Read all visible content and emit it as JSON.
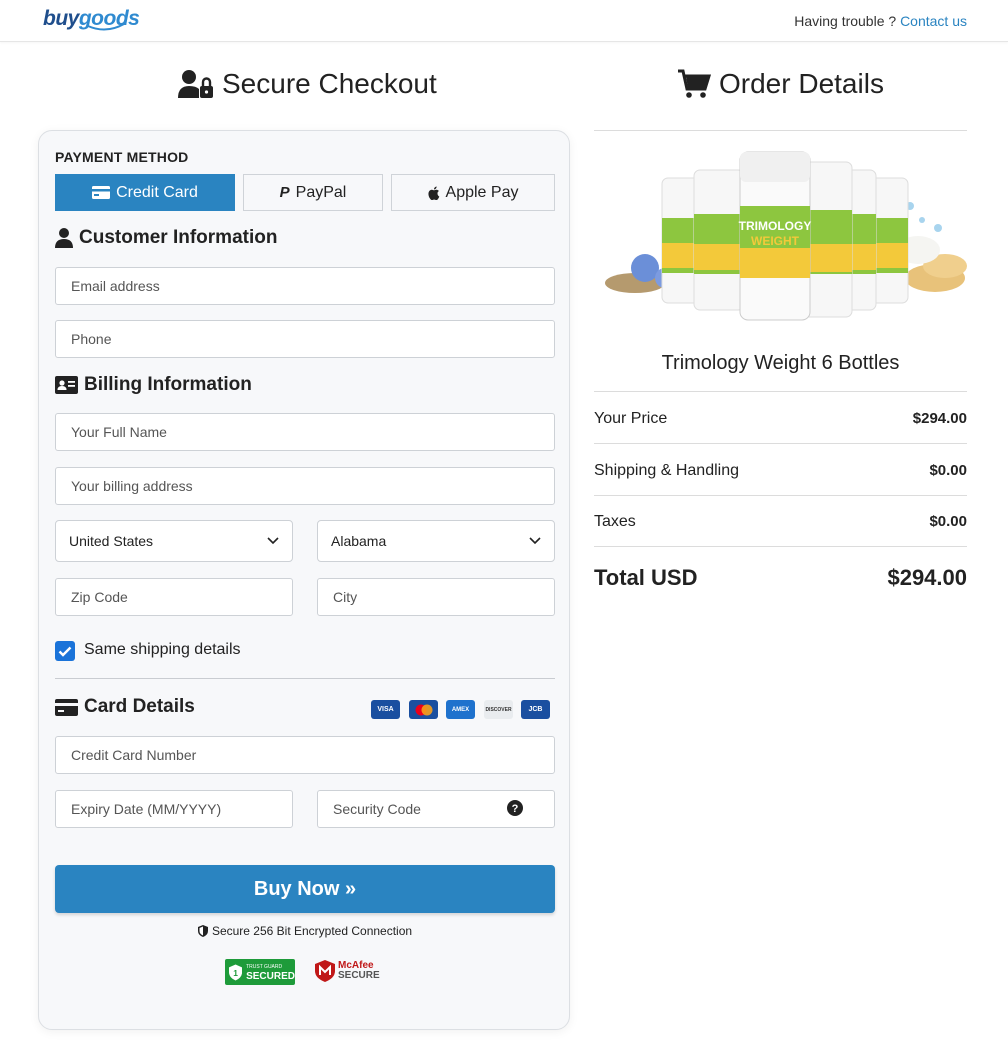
{
  "header": {
    "logo_part1": "buy",
    "logo_part2": "goods",
    "help_text": "Having trouble ?",
    "help_link": "Contact us"
  },
  "checkout": {
    "title": "Secure Checkout",
    "payment_method_label": "PAYMENT METHOD",
    "payment_methods": [
      {
        "label": "Credit Card",
        "icon": "credit-card-icon",
        "active": true
      },
      {
        "label": "PayPal",
        "icon": "paypal-icon",
        "active": false
      },
      {
        "label": "Apple Pay",
        "icon": "apple-icon",
        "active": false
      }
    ],
    "customer_title": "Customer Information",
    "email_placeholder": "Email address",
    "phone_placeholder": "Phone",
    "billing_title": "Billing Information",
    "fullname_placeholder": "Your Full Name",
    "address_placeholder": "Your billing address",
    "country_value": "United States",
    "state_value": "Alabama",
    "zip_placeholder": "Zip Code",
    "city_placeholder": "City",
    "same_shipping_label": "Same shipping details",
    "same_shipping_checked": true,
    "card_title": "Card Details",
    "card_brands": [
      "VISA",
      "MC",
      "AMEX",
      "DISCOVER",
      "JCB"
    ],
    "card_number_placeholder": "Credit Card Number",
    "expiry_placeholder": "Expiry Date (MM/YYYY)",
    "cvv_placeholder": "Security Code",
    "buy_label": "Buy Now »",
    "secure_text": "Secure 256 Bit Encrypted Connection",
    "trust_badge": "SECURED",
    "trust_badge_top": "TRUST GUARD",
    "mcafee_line1": "McAfee",
    "mcafee_line2": "SECURE"
  },
  "order": {
    "title": "Order Details",
    "product_name": "Trimology Weight 6 Bottles",
    "bottle_label1": "TRIMOLOGY",
    "bottle_label2": "WEIGHT",
    "rows": [
      {
        "label": "Your Price",
        "value": "$294.00"
      },
      {
        "label": "Shipping & Handling",
        "value": "$0.00"
      },
      {
        "label": "Taxes",
        "value": "$0.00"
      }
    ],
    "total_label": "Total USD",
    "total_value": "$294.00"
  },
  "colors": {
    "primary": "#2a84c1",
    "check": "#1a73d9",
    "bottle_green": "#8dc63f"
  }
}
